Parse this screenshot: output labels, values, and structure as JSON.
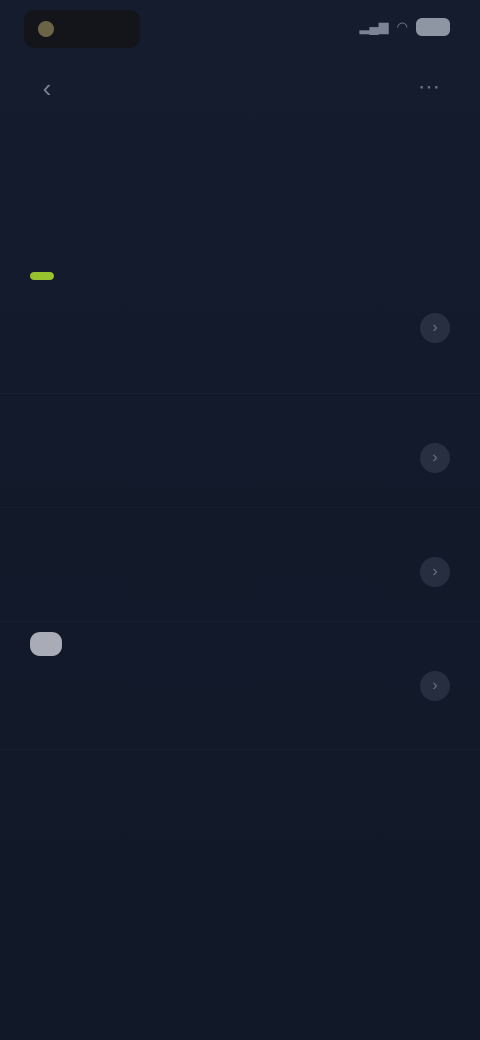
{
  "status_bar": {
    "time": "",
    "signal_icon": "signal-icon",
    "wifi_icon": "wifi-icon",
    "battery_icon": "battery-icon"
  },
  "header": {
    "title": "",
    "back_icon": "back-arrow-icon",
    "menu_icon": "more-icon"
  },
  "intro": {
    "heading": "",
    "text": ""
  },
  "items": [
    {
      "badge": "",
      "title": "",
      "description": ""
    },
    {
      "badge": "",
      "title": "",
      "description": ""
    },
    {
      "badge": "",
      "title": "",
      "description": ""
    },
    {
      "badge": "",
      "title": "",
      "description": ""
    }
  ],
  "colors": {
    "background": "#111827",
    "accent_green": "#98c22e",
    "badge_grey": "#a9acb6"
  }
}
